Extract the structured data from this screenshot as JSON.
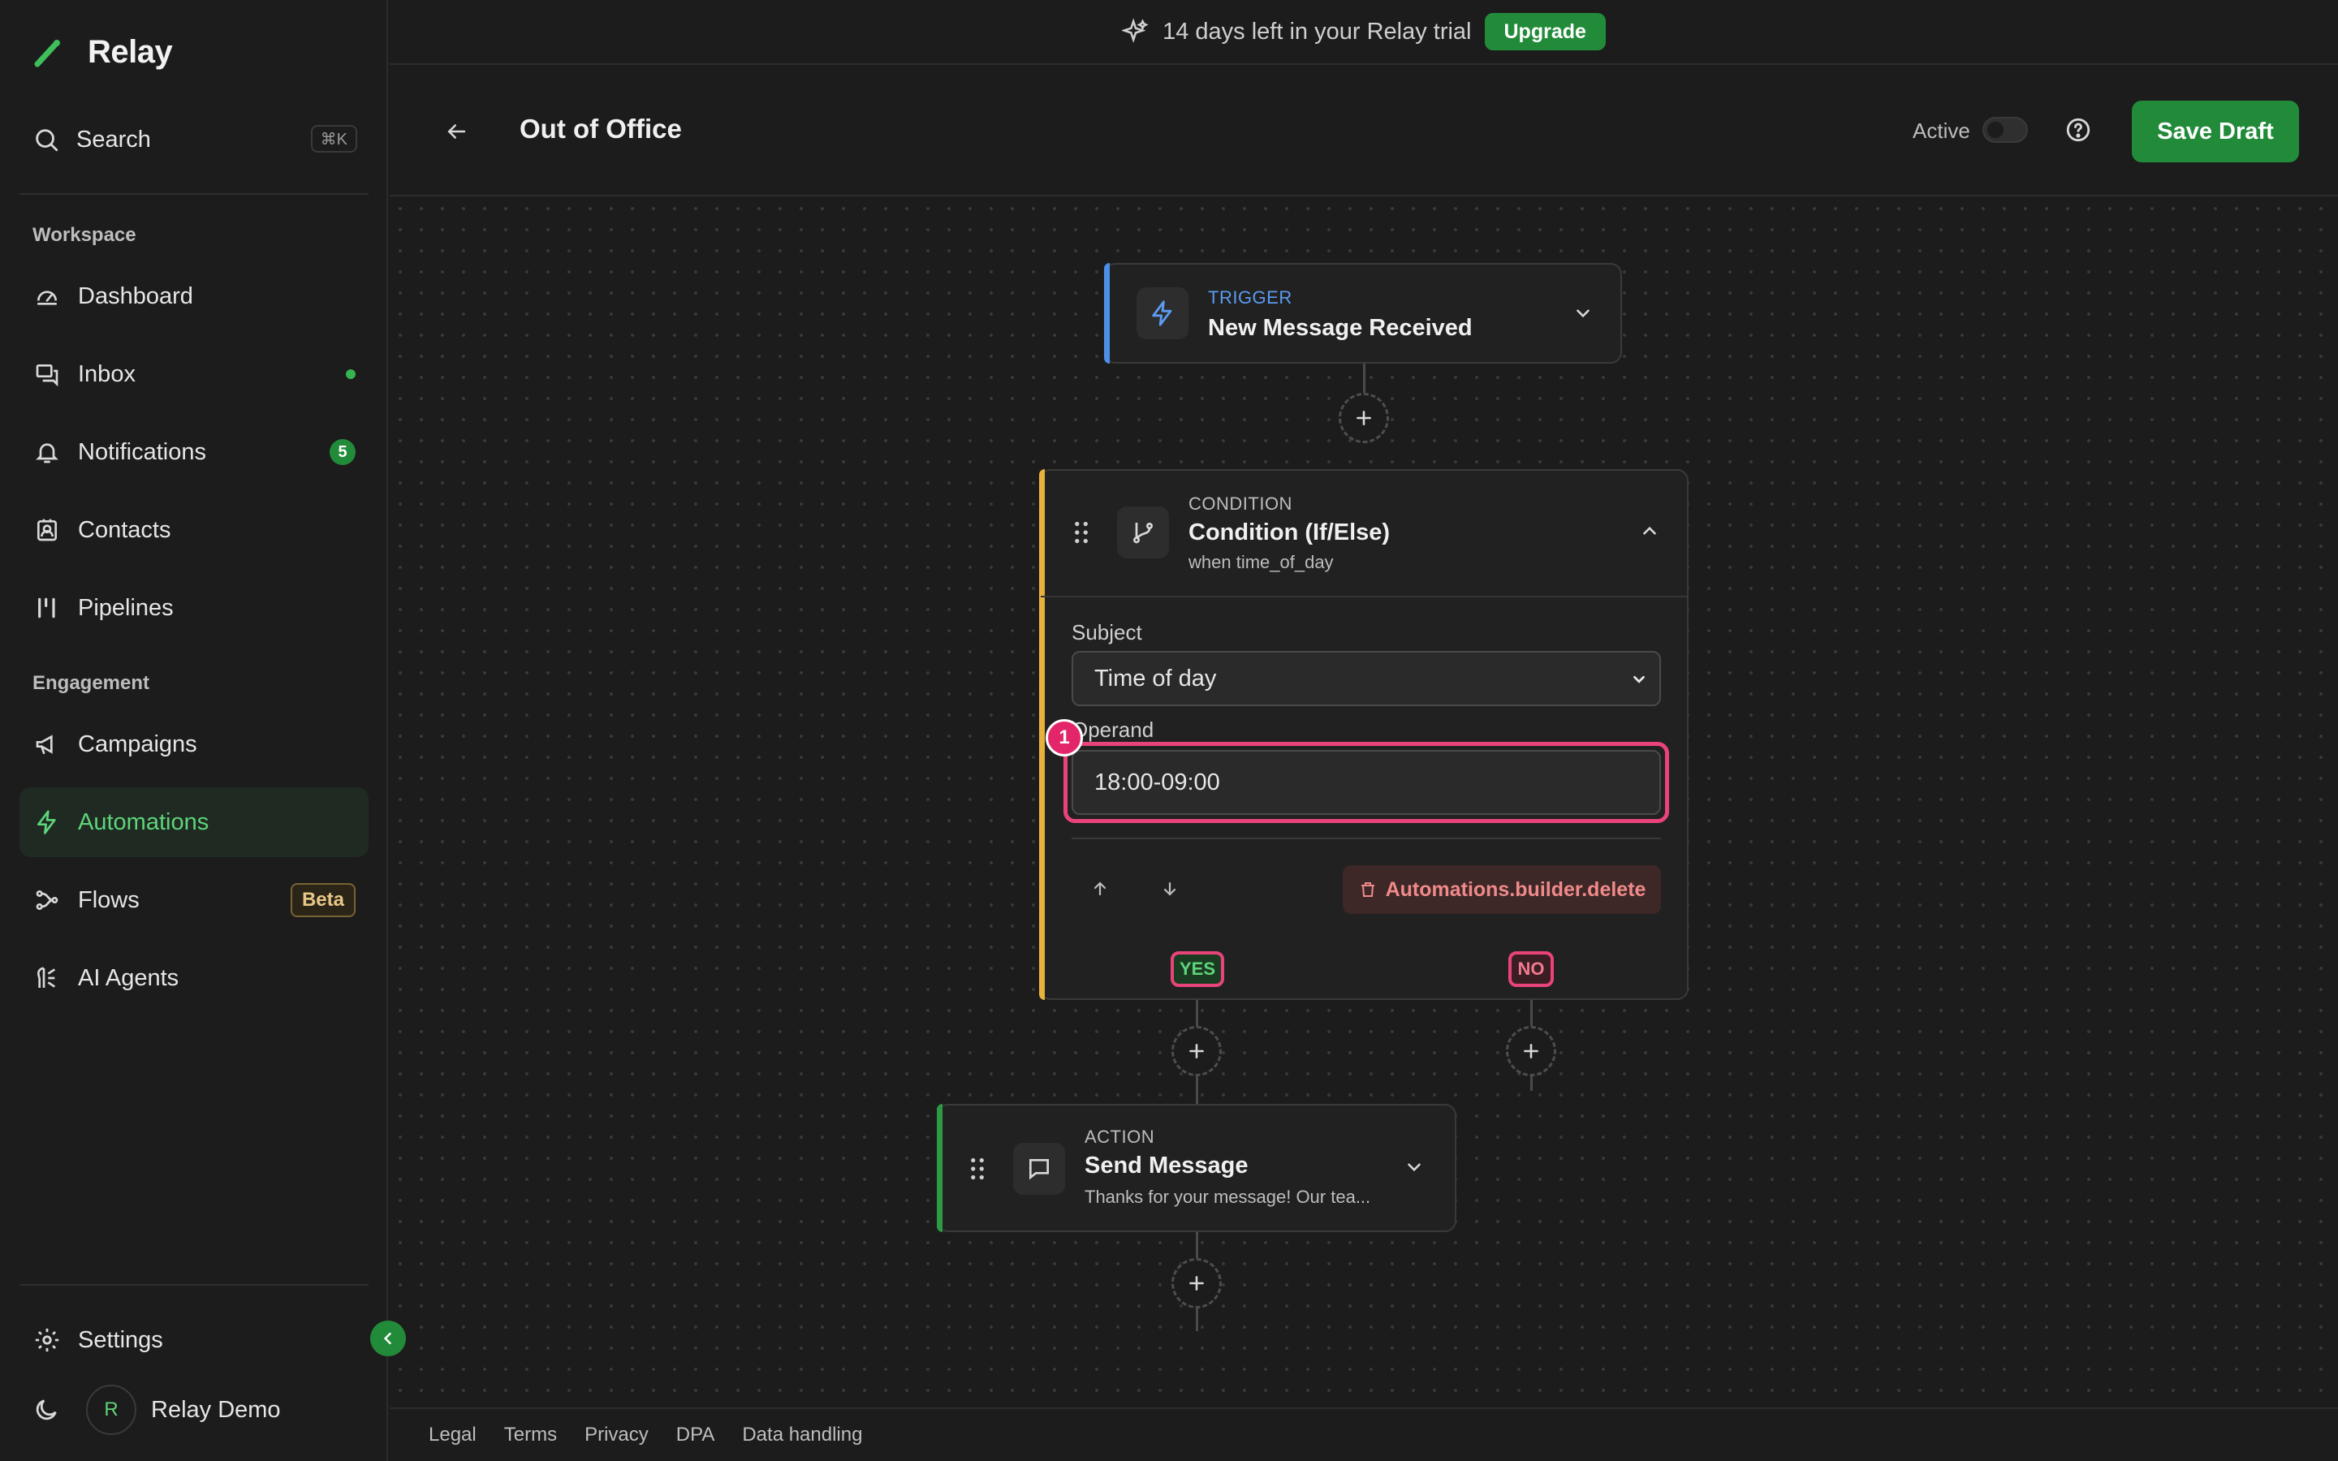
{
  "app": {
    "name": "Relay"
  },
  "search": {
    "label": "Search",
    "shortcut": "⌘K"
  },
  "sidebar": {
    "sections": {
      "workspace": "Workspace",
      "engagement": "Engagement"
    },
    "items": [
      {
        "label": "Dashboard",
        "icon": "dashboard-icon"
      },
      {
        "label": "Inbox",
        "icon": "inbox-icon"
      },
      {
        "label": "Notifications",
        "icon": "bell-icon",
        "badge": "5"
      },
      {
        "label": "Contacts",
        "icon": "contacts-icon"
      },
      {
        "label": "Pipelines",
        "icon": "pipeline-icon"
      },
      {
        "label": "Campaigns",
        "icon": "megaphone-icon"
      },
      {
        "label": "Automations",
        "icon": "bolt-icon",
        "active": true
      },
      {
        "label": "Flows",
        "icon": "flows-icon",
        "tag": "Beta"
      },
      {
        "label": "AI Agents",
        "icon": "ai-agent-icon"
      }
    ],
    "settings": "Settings",
    "user": {
      "initial": "R",
      "name": "Relay Demo"
    }
  },
  "banner": {
    "text": "14 days left in your Relay trial",
    "cta": "Upgrade"
  },
  "header": {
    "title": "Out of Office",
    "active_label": "Active",
    "save_label": "Save Draft"
  },
  "flow": {
    "trigger": {
      "kind": "TRIGGER",
      "title": "New Message Received"
    },
    "condition": {
      "kind": "CONDITION",
      "title": "Condition (If/Else)",
      "subtitle": "when time_of_day",
      "subject_label": "Subject",
      "subject_value": "Time of day",
      "operand_label": "Operand",
      "operand_value": "18:00-09:00",
      "delete_label": "Automations.builder.delete",
      "marker": "1"
    },
    "branches": {
      "yes": "YES",
      "no": "NO"
    },
    "action": {
      "kind": "ACTION",
      "title": "Send Message",
      "subtitle": "Thanks for your message! Our tea..."
    }
  },
  "footer": {
    "links": [
      "Legal",
      "Terms",
      "Privacy",
      "DPA",
      "Data handling"
    ]
  },
  "colors": {
    "accent": "#228b3a",
    "highlight": "#e9447a",
    "trigger": "#4d8fe8",
    "condition": "#e8b13a",
    "action": "#2e9a46"
  }
}
